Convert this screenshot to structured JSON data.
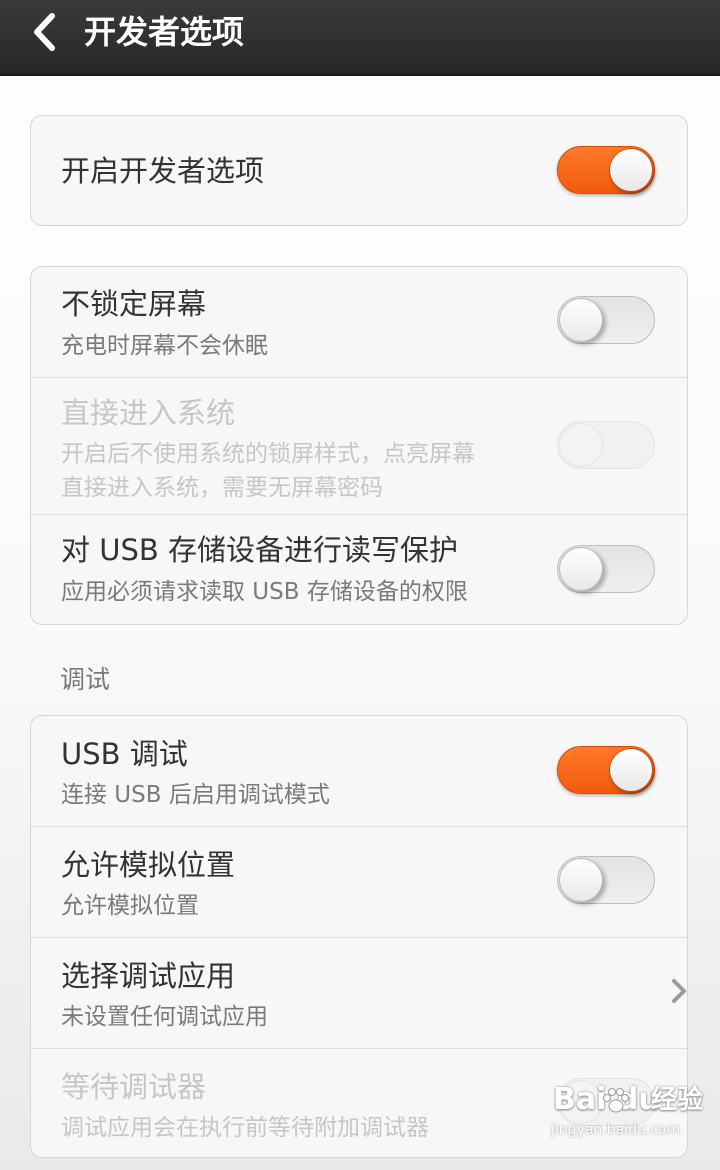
{
  "header": {
    "title": "开发者选项",
    "back_icon": "chevron-left-icon"
  },
  "accent_color": "#f4640f",
  "master": {
    "label": "开启开发者选项",
    "enabled": true
  },
  "general": [
    {
      "title": "不锁定屏幕",
      "subtitle": "充电时屏幕不会休眠",
      "enabled": false,
      "disabled": false
    },
    {
      "title": "直接进入系统",
      "subtitle_line1": "开启后不使用系统的锁屏样式，点亮屏幕",
      "subtitle_line2": "直接进入系统，需要无屏幕密码",
      "enabled": false,
      "disabled": true
    },
    {
      "title": "对 USB 存储设备进行读写保护",
      "subtitle": "应用必须请求读取 USB 存储设备的权限",
      "enabled": false,
      "disabled": false
    }
  ],
  "debug_section": {
    "label": "调试",
    "items": [
      {
        "title": "USB 调试",
        "subtitle": "连接 USB 后启用调试模式",
        "enabled": true,
        "disabled": false
      },
      {
        "title": "允许模拟位置",
        "subtitle": "允许模拟位置",
        "enabled": false,
        "disabled": false
      },
      {
        "title": "选择调试应用",
        "subtitle": "未设置任何调试应用",
        "control": "chevron-right-icon"
      },
      {
        "title": "等待调试器",
        "subtitle": "调试应用会在执行前等待附加调试器",
        "enabled": false,
        "disabled": true
      }
    ]
  },
  "watermark": {
    "brand": "Bai du",
    "cn": "经验",
    "url": "jingyan.baidu.com"
  }
}
